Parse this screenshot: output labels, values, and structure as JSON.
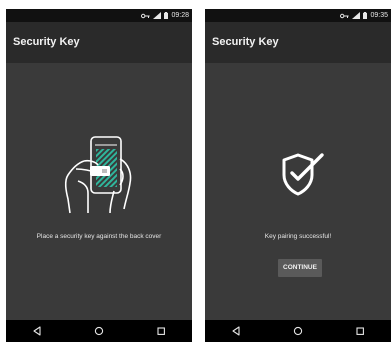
{
  "screens": [
    {
      "status": {
        "time": "09:28"
      },
      "app_bar": {
        "title": "Security Key"
      },
      "message": "Place a security key against the back cover",
      "illustration_icon": "phone-with-security-key-icon"
    },
    {
      "status": {
        "time": "09:35"
      },
      "app_bar": {
        "title": "Security Key"
      },
      "message": "Key pairing successful!",
      "continue_label": "CONTINUE",
      "illustration_icon": "shield-check-icon"
    }
  ],
  "nav_icons": [
    "back-icon",
    "home-icon",
    "recents-icon"
  ],
  "colors": {
    "status_bar": "#111111",
    "app_bar": "#2a2a2a",
    "content_bg": "#3a3a3a",
    "nav_bar": "#000000",
    "accent": "#2ec4a7"
  }
}
